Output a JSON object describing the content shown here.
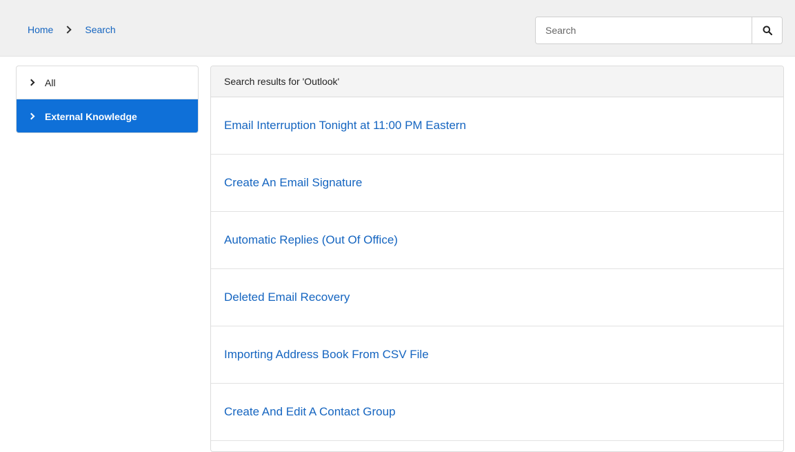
{
  "breadcrumb": {
    "items": [
      {
        "label": "Home"
      },
      {
        "label": "Search"
      }
    ]
  },
  "search": {
    "placeholder": "Search",
    "value": "",
    "button_icon": "search-icon"
  },
  "sidebar": {
    "items": [
      {
        "label": "All",
        "active": false,
        "icon": "chevron-right-icon"
      },
      {
        "label": "External Knowledge",
        "active": true,
        "icon": "chevron-right-icon"
      }
    ]
  },
  "results": {
    "header": "Search results for 'Outlook'",
    "items": [
      {
        "title": "Email Interruption Tonight at 11:00 PM Eastern"
      },
      {
        "title": "Create An Email Signature"
      },
      {
        "title": "Automatic Replies (Out Of Office)"
      },
      {
        "title": "Deleted Email Recovery"
      },
      {
        "title": "Importing Address Book From CSV File"
      },
      {
        "title": "Create And Edit A Contact Group"
      }
    ]
  },
  "colors": {
    "accent": "#0f70d8",
    "link": "#1565c0",
    "topbar_bg": "#f0f0f0",
    "header_bg": "#f4f4f4"
  }
}
